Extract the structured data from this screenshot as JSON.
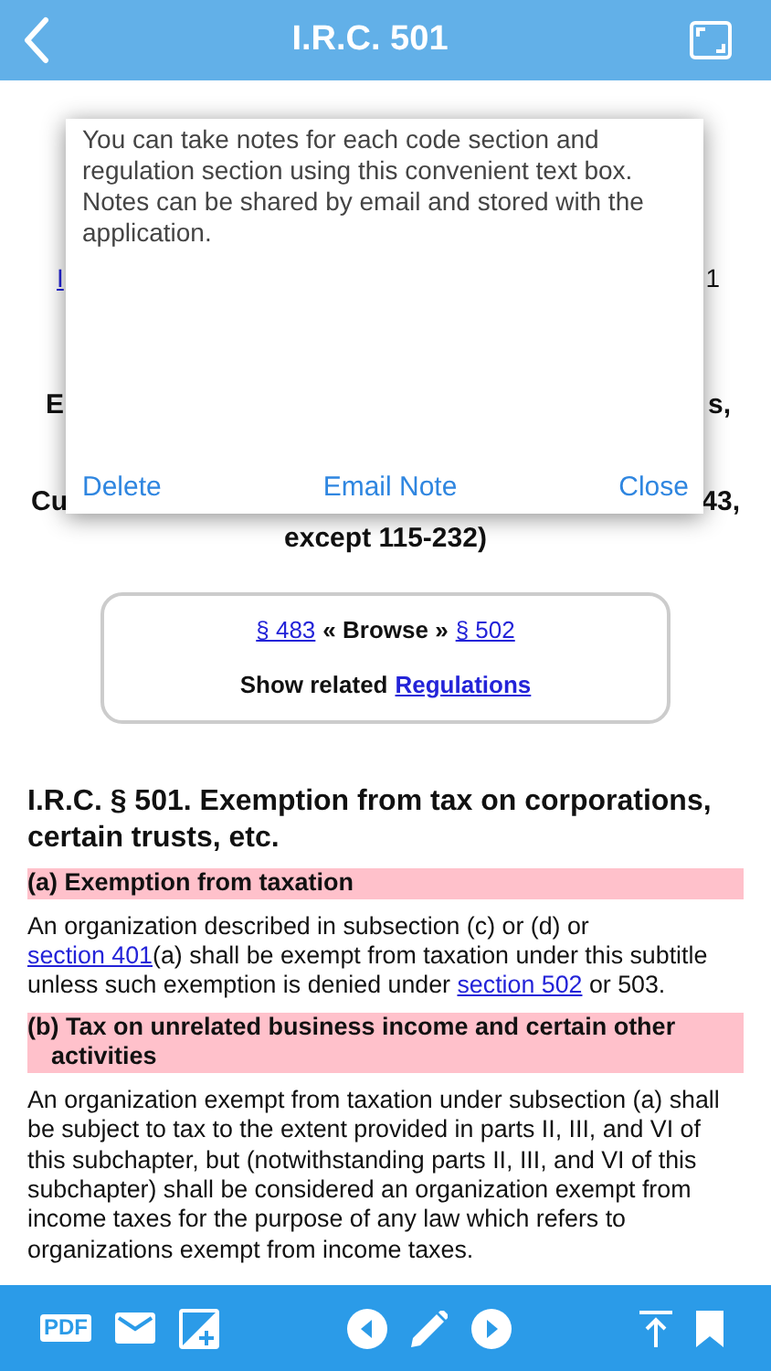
{
  "nav": {
    "title": "I.R.C. 501"
  },
  "covered_rows": [
    {
      "left": {
        "text": "I",
        "kind": "link"
      },
      "right": {
        "text": "1",
        "kind": "plain"
      }
    },
    {
      "left": {
        "text": "E",
        "kind": "bold"
      },
      "right": {
        "text": "s,",
        "kind": "bold"
      }
    },
    {
      "left": {
        "text": "Cu",
        "kind": "bold"
      },
      "right": {
        "text": "43,",
        "kind": "bold"
      }
    }
  ],
  "covered_tail": "except 115-232)",
  "note_popup": {
    "text": "You can take notes for each code section and regulation section using this convenient text box. Notes can be shared by email and stored with the application.",
    "actions": [
      {
        "label": "Delete"
      },
      {
        "label": "Email Note"
      },
      {
        "label": "Close"
      }
    ]
  },
  "browse": {
    "prev_link": "§ 483",
    "label": "« Browse »",
    "next_link": "§ 502",
    "related_label": "Show related",
    "related_link": "Regulations"
  },
  "section": {
    "heading": "I.R.C. § 501.  Exemption from tax on corporations, certain trusts, etc.",
    "subsections": [
      {
        "heading": "(a) Exemption from taxation",
        "paragraph": [
          {
            "text": "An organization described in subsection (c) or (d) or ",
            "link": false
          },
          {
            "text": "section 401",
            "link": true
          },
          {
            "text": "(a) shall be exempt from taxation under this subtitle unless such exemption is denied under ",
            "link": false
          },
          {
            "text": "section 502",
            "link": true
          },
          {
            "text": " or 503.",
            "link": false
          }
        ]
      },
      {
        "heading": "(b) Tax on unrelated business income and certain other activities",
        "paragraph": [
          {
            "text": "An organization exempt from taxation under subsection (a) shall be subject to tax to the extent provided in parts II, III, and VI of this subchapter, but (notwithstanding parts II, III, and VI of this subchapter) shall be considered an organization exempt from income taxes for the purpose of any law which refers to organizations exempt from income taxes.",
            "link": false
          }
        ]
      }
    ]
  },
  "toolbar": [
    {
      "kind": "pdf",
      "label": "PDF"
    },
    {
      "kind": "mail"
    },
    {
      "kind": "image"
    },
    {
      "kind": "gap"
    },
    {
      "kind": "prev"
    },
    {
      "kind": "pencil"
    },
    {
      "kind": "next"
    },
    {
      "kind": "gap"
    },
    {
      "kind": "top"
    },
    {
      "kind": "bookmark"
    }
  ]
}
